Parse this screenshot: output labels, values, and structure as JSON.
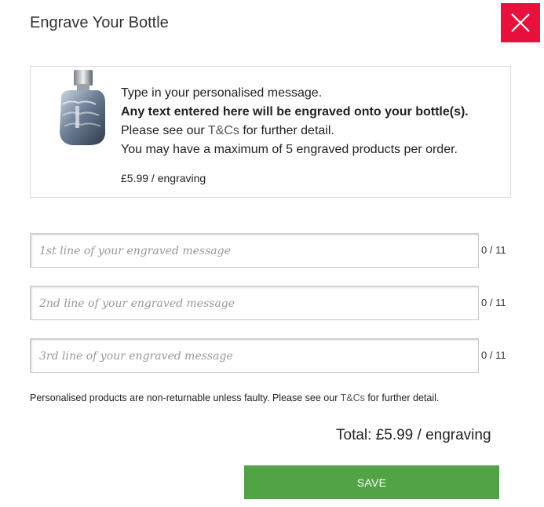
{
  "modal": {
    "title": "Engrave Your Bottle",
    "close_icon": "close-icon",
    "accent_color": "#e8103c"
  },
  "info": {
    "line1": "Type in your personalised message.",
    "line2": "Any text entered here will be engraved onto your bottle(s).",
    "line3_before": "Please see our ",
    "line3_link": "T&Cs",
    "line3_after": " for further detail.",
    "line4": "You may have a maximum of 5 engraved products per order.",
    "price": "£5.99 / engraving",
    "image": "perfume-bottle-fist"
  },
  "fields": [
    {
      "placeholder": "1st line of your engraved message",
      "value": "",
      "counter": "0 / 11"
    },
    {
      "placeholder": "2nd line of your engraved message",
      "value": "",
      "counter": "0 / 11"
    },
    {
      "placeholder": "3rd line of your engraved message",
      "value": "",
      "counter": "0 / 11"
    }
  ],
  "disclaimer": {
    "before": "Personalised products are non-returnable unless faulty. Please see our ",
    "link": "T&Cs",
    "after": " for further detail."
  },
  "total": "Total: £5.99 / engraving",
  "save_label": "SAVE",
  "save_color": "#52a345"
}
